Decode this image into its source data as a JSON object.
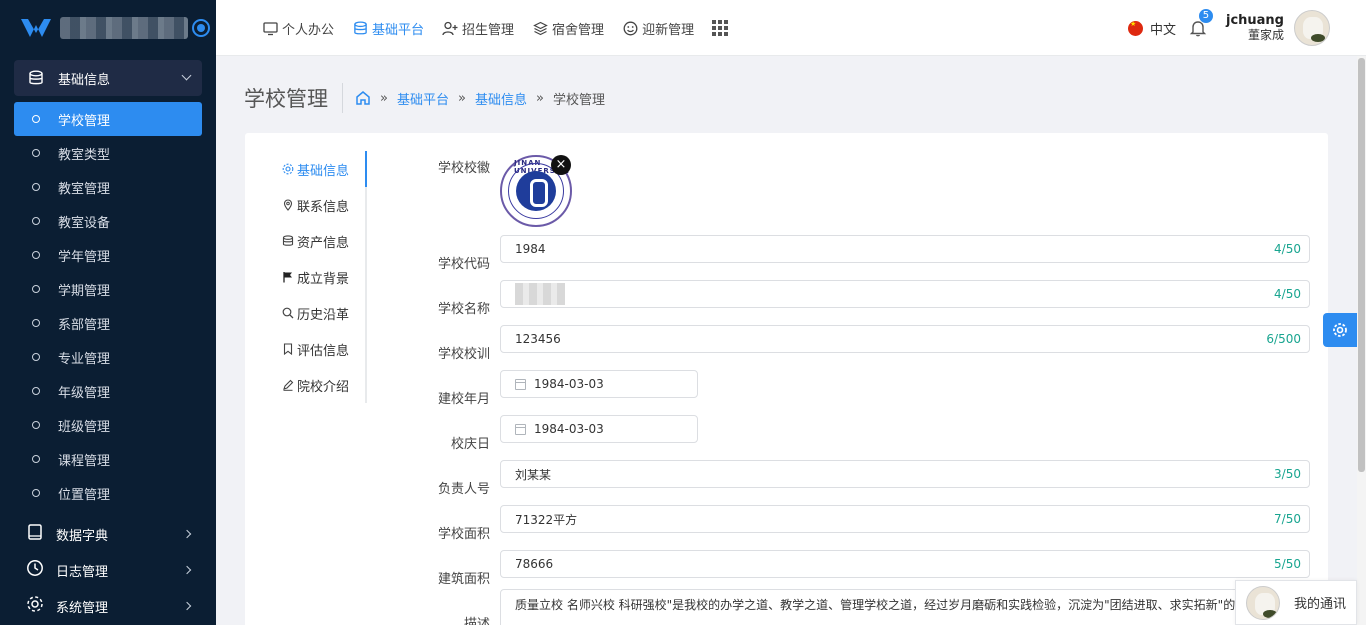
{
  "sidebar": {
    "group": {
      "label": "基础信息",
      "icon": "database-icon"
    },
    "items": [
      {
        "label": "学校管理",
        "active": true
      },
      {
        "label": "教室类型"
      },
      {
        "label": "教室管理"
      },
      {
        "label": "教室设备"
      },
      {
        "label": "学年管理"
      },
      {
        "label": "学期管理"
      },
      {
        "label": "系部管理"
      },
      {
        "label": "专业管理"
      },
      {
        "label": "年级管理"
      },
      {
        "label": "班级管理"
      },
      {
        "label": "课程管理"
      },
      {
        "label": "位置管理"
      }
    ],
    "menus": [
      {
        "label": "数据字典",
        "icon": "book-icon"
      },
      {
        "label": "日志管理",
        "icon": "clock-icon"
      },
      {
        "label": "系统管理",
        "icon": "gear-icon"
      }
    ]
  },
  "header": {
    "nav": [
      {
        "label": "个人办公",
        "icon": "monitor-icon"
      },
      {
        "label": "基础平台",
        "icon": "database-icon",
        "active": true
      },
      {
        "label": "招生管理",
        "icon": "user-add-icon"
      },
      {
        "label": "宿舍管理",
        "icon": "layers-icon"
      },
      {
        "label": "迎新管理",
        "icon": "smile-icon"
      }
    ],
    "language": "中文",
    "notification_count": "5",
    "user": {
      "name": "jchuang",
      "role": "董家成"
    }
  },
  "page": {
    "title": "学校管理",
    "breadcrumb": [
      "基础平台",
      "基础信息",
      "学校管理"
    ],
    "breadcrumb_sep": "»"
  },
  "tabs": [
    {
      "label": "基础信息",
      "icon": "settings-icon",
      "active": true
    },
    {
      "label": "联系信息",
      "icon": "location-icon"
    },
    {
      "label": "资产信息",
      "icon": "database-icon"
    },
    {
      "label": "成立背景",
      "icon": "flag-icon"
    },
    {
      "label": "历史沿革",
      "icon": "search-icon"
    },
    {
      "label": "评估信息",
      "icon": "bookmark-icon"
    },
    {
      "label": "院校介绍",
      "icon": "pen-icon"
    }
  ],
  "form": {
    "emblem_label": "学校校徽",
    "emblem_text": "JINAN UNIVERSITY",
    "code": {
      "label": "学校代码",
      "value": "1984",
      "counter": "4/50"
    },
    "name": {
      "label": "学校名称",
      "value": "",
      "counter": "4/50"
    },
    "motto": {
      "label": "学校校训",
      "value": "123456",
      "counter": "6/500"
    },
    "founded": {
      "label": "建校年月",
      "value": "1984-03-03"
    },
    "anniversary": {
      "label": "校庆日",
      "value": "1984-03-03"
    },
    "leader": {
      "label": "负责人号",
      "value": "刘某某",
      "counter": "3/50"
    },
    "area": {
      "label": "学校面积",
      "value": "71322平方",
      "counter": "7/50"
    },
    "building_area": {
      "label": "建筑面积",
      "value": "78666",
      "counter": "5/50"
    },
    "description": {
      "label": "描述",
      "value": "质量立校 名师兴校 科研强校\"是我校的办学之道、教学之道、管理学校之道，经过岁月磨砺和实践检验，沉淀为\"团结进取、求实拓新\"的校"
    }
  },
  "chat": {
    "label": "我的通讯"
  },
  "colors": {
    "primary": "#2d8cf0",
    "sidebar_bg": "#0b1e33",
    "counter": "#19a590"
  }
}
